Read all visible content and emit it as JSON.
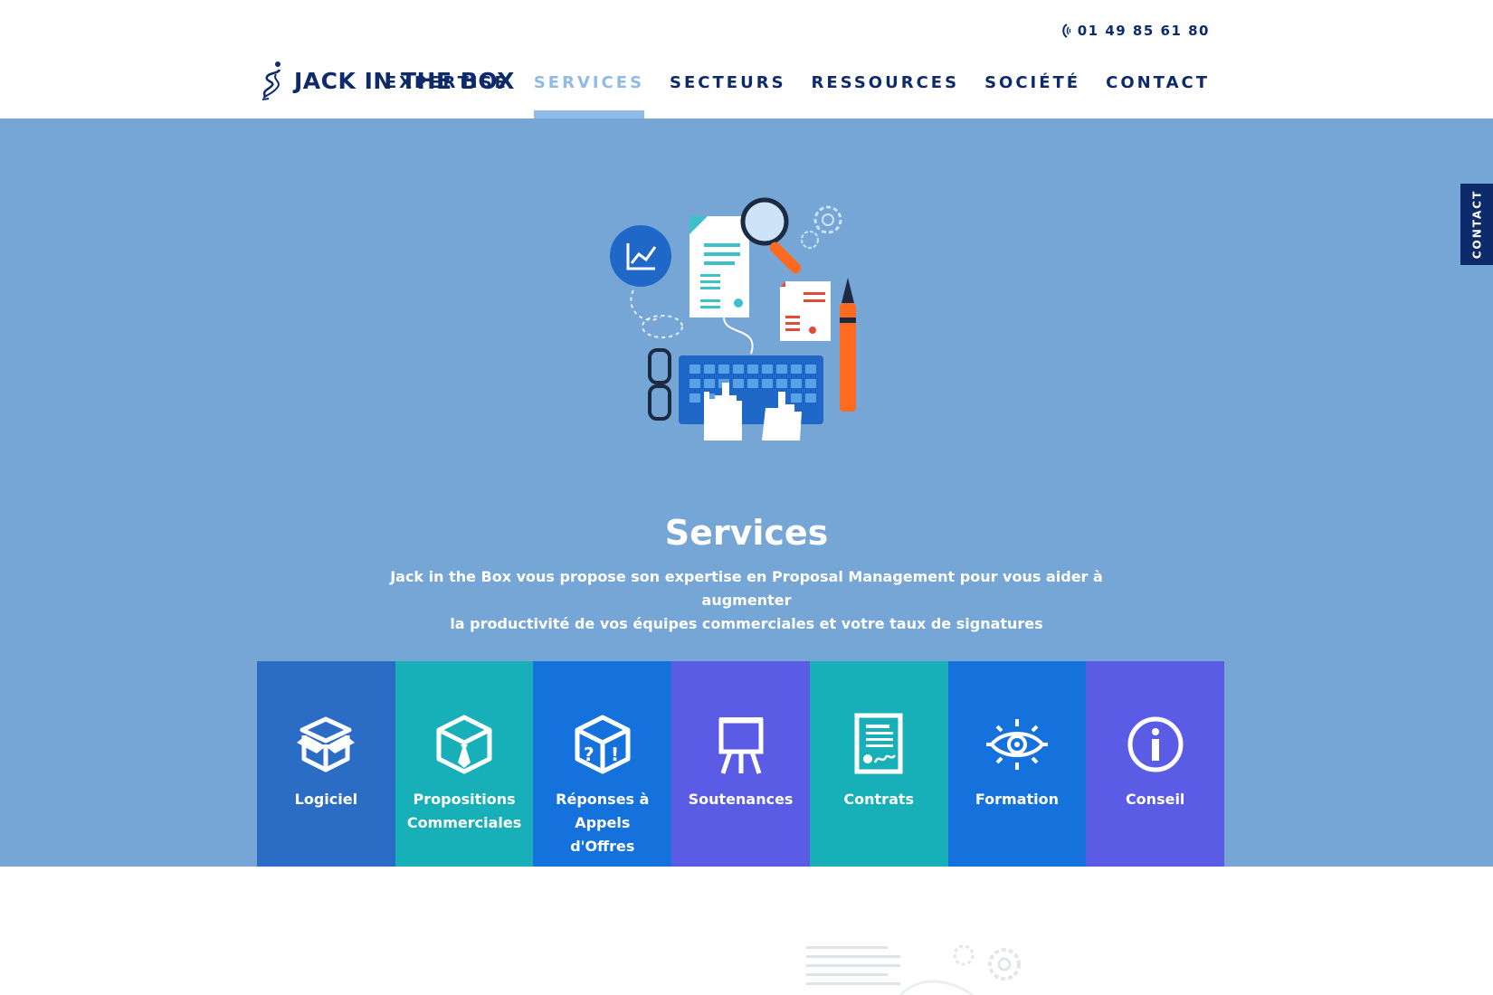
{
  "header": {
    "phone": "01 49 85 61 80",
    "brand": "JACK IN THE BOX",
    "nav": [
      {
        "label": "EXPERTISE",
        "active": false
      },
      {
        "label": "SERVICES",
        "active": true
      },
      {
        "label": "SECTEURS",
        "active": false
      },
      {
        "label": "RESSOURCES",
        "active": false
      },
      {
        "label": "SOCIÉTÉ",
        "active": false
      },
      {
        "label": "CONTACT",
        "active": false
      }
    ]
  },
  "hero": {
    "title": "Services",
    "subtitle_line1": "Jack in the Box vous propose son expertise en Proposal Management pour vous aider à augmenter",
    "subtitle_line2": "la productivité de vos équipes commerciales et votre taux de signatures"
  },
  "tiles": [
    {
      "label": "Logiciel",
      "icon": "open-box-icon",
      "color": "#2b6cc4"
    },
    {
      "label": "Propositions Commerciales",
      "icon": "box-tie-icon",
      "color": "#18b0b8"
    },
    {
      "label": "Réponses à Appels d'Offres",
      "icon": "box-question-icon",
      "color": "#1572dd"
    },
    {
      "label": "Soutenances",
      "icon": "easel-icon",
      "color": "#5a5ce6"
    },
    {
      "label": "Contrats",
      "icon": "contract-icon",
      "color": "#18b0b8"
    },
    {
      "label": "Formation",
      "icon": "eye-icon",
      "color": "#1572dd"
    },
    {
      "label": "Conseil",
      "icon": "info-icon",
      "color": "#5a5ce6"
    }
  ],
  "side_tab": {
    "label": "CONTACT"
  },
  "colors": {
    "navy": "#0d2a6b",
    "hero_bg": "#76a6d6",
    "nav_active": "#8fbbe6"
  }
}
